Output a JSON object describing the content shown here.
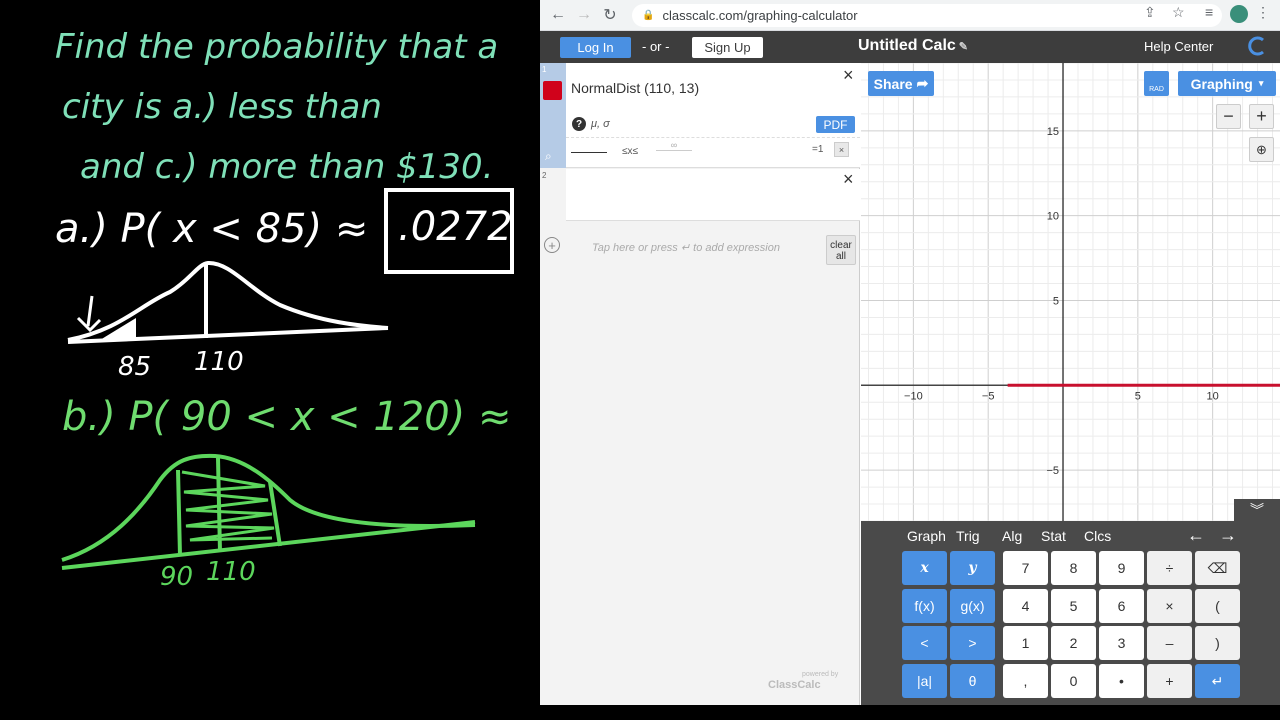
{
  "board": {
    "line1": "Find the probability that a",
    "line2": "city is   a.) less than",
    "line3": "and c.)  more than $130.",
    "part_a": "a.)  P( x < 85) ≈",
    "part_a_answer": ".0272",
    "curve_a_labels": [
      "85",
      "110"
    ],
    "part_b": "b.)  P( 90 < x < 120) ≈",
    "curve_b_labels": [
      "90",
      "110"
    ]
  },
  "browser": {
    "url": "classcalc.com/graphing-calculator"
  },
  "app": {
    "login": "Log In",
    "or": "- or -",
    "signup": "Sign Up",
    "title": "Untitled Calc",
    "help": "Help Center"
  },
  "expressions": [
    {
      "index": "1",
      "text": "NormalDist (110, 13)",
      "params": "μ, σ",
      "pdf": "PDF",
      "range_op": "≤x≤",
      "range_hi": "∞",
      "eq": "=1",
      "close": "×",
      "color": "#d0021b"
    },
    {
      "index": "2",
      "close": "×"
    }
  ],
  "add_hint": "Tap here or press   ↵   to add expression",
  "clear_all": "clear all",
  "powered": "ClassCalc",
  "powered_small": "powered by",
  "graph": {
    "share": "Share",
    "rad": "RAD",
    "mode": "Graphing",
    "xlim": [
      -13.5,
      14.5
    ],
    "ylim": [
      -8,
      19
    ],
    "x_ticks": [
      -10,
      -5,
      5,
      10
    ],
    "y_ticks": [
      15,
      10,
      5,
      -5
    ],
    "curve_color": "#c8102e",
    "curve_from_x": -3.7
  },
  "keypad": {
    "tabs": [
      "Graph",
      "Trig",
      "Alg",
      "Stat",
      "Clcs"
    ],
    "rows": [
      [
        "x",
        "y",
        "7",
        "8",
        "9",
        "÷",
        "⌫"
      ],
      [
        "f(x)",
        "g(x)",
        "4",
        "5",
        "6",
        "×",
        "("
      ],
      [
        "<",
        ">",
        "1",
        "2",
        "3",
        "–",
        ")"
      ],
      [
        "|a|",
        "θ",
        ",",
        "0",
        "•",
        "+",
        "↵"
      ]
    ]
  }
}
